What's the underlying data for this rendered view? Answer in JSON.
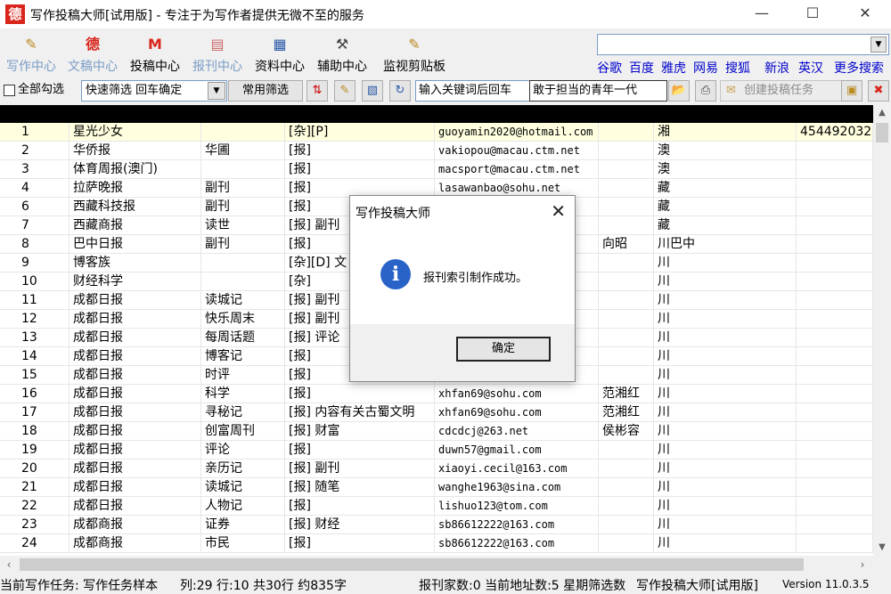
{
  "window": {
    "title": "写作投稿大师[试用版] - 专注于为写作者提供无微不至的服务",
    "icon_label": "德"
  },
  "nav": [
    {
      "label": "写作中心",
      "icon": "pencil-doc-icon",
      "dim": true
    },
    {
      "label": "文稿中心",
      "icon": "logo-icon",
      "dim": true
    },
    {
      "label": "投稿中心",
      "icon": "mail-icon",
      "dim": false
    },
    {
      "label": "报刊中心",
      "icon": "newspaper-icon",
      "dim": true
    },
    {
      "label": "资料中心",
      "icon": "book-icon",
      "dim": false
    },
    {
      "label": "辅助中心",
      "icon": "hammer-icon",
      "dim": false
    },
    {
      "label": "监视剪贴板",
      "icon": "clipboard-icon",
      "dim": false
    }
  ],
  "top_combo": {
    "value": ""
  },
  "search_links": [
    "谷歌",
    "百度",
    "雅虎",
    "网易",
    "搜狐",
    "新浪",
    "英汉",
    "更多搜索"
  ],
  "toolbar2": {
    "select_all": "全部勾选",
    "filter_select": "快速筛选  回车确定",
    "common_filter": "常用筛选",
    "keyword_input": "输入关键词后回车",
    "text_field": "敢于担当的青年一代",
    "create_task": "创建投稿任务"
  },
  "table": {
    "rows": [
      [
        "1",
        "星光少女",
        "",
        "[杂][P]",
        "guoyamin2020@hotmail.com",
        "",
        "湘",
        "454492032"
      ],
      [
        "2",
        "华侨报",
        "华圃",
        "[报]",
        "vakiopou@macau.ctm.net",
        "",
        "澳",
        ""
      ],
      [
        "3",
        "体育周报(澳门)",
        "",
        "[报]",
        "macsport@macau.ctm.net",
        "",
        "澳",
        ""
      ],
      [
        "4",
        "拉萨晚报",
        "副刊",
        "[报]",
        "lasawanbao@sohu.net",
        "",
        "藏",
        ""
      ],
      [
        "6",
        "西藏科技报",
        "副刊",
        "[报]",
        "",
        "",
        "藏",
        ""
      ],
      [
        "7",
        "西藏商报",
        "读世",
        "[报] 副刊",
        "",
        "",
        "藏",
        ""
      ],
      [
        "8",
        "巴中日报",
        "副刊",
        "[报]",
        "",
        "向昭",
        "川巴中",
        ""
      ],
      [
        "9",
        "博客族",
        "",
        "[杂][D] 文",
        "",
        "",
        "川",
        ""
      ],
      [
        "10",
        "财经科学",
        "",
        "[杂]",
        "",
        "",
        "川",
        ""
      ],
      [
        "11",
        "成都日报",
        "读城记",
        "[报] 副刊",
        "cn",
        "",
        "川",
        ""
      ],
      [
        "12",
        "成都日报",
        "快乐周末",
        "[报] 副刊",
        "",
        "",
        "川",
        ""
      ],
      [
        "13",
        "成都日报",
        "每周话题",
        "[报] 评论",
        "cn",
        "",
        "川",
        ""
      ],
      [
        "14",
        "成都日报",
        "博客记",
        "[报]",
        "cn",
        "",
        "川",
        ""
      ],
      [
        "15",
        "成都日报",
        "时评",
        "[报]",
        "",
        "",
        "川",
        ""
      ],
      [
        "16",
        "成都日报",
        "科学",
        "[报]",
        "xhfan69@sohu.com",
        "范湘红",
        "川",
        ""
      ],
      [
        "17",
        "成都日报",
        "寻秘记",
        "[报] 内容有关古蜀文明",
        "xhfan69@sohu.com",
        "范湘红",
        "川",
        ""
      ],
      [
        "18",
        "成都日报",
        "创富周刊",
        "[报] 财富",
        "cdcdcj@263.net",
        "侯彬容",
        "川",
        ""
      ],
      [
        "19",
        "成都日报",
        "评论",
        "[报]",
        "duwn57@gmail.com",
        "",
        "川",
        ""
      ],
      [
        "20",
        "成都日报",
        "亲历记",
        "[报] 副刊",
        "xiaoyi.cecil@163.com",
        "",
        "川",
        ""
      ],
      [
        "21",
        "成都日报",
        "读城记",
        "[报] 随笔",
        "wanghe1963@sina.com",
        "",
        "川",
        ""
      ],
      [
        "22",
        "成都日报",
        "人物记",
        "[报]",
        "lishuo123@tom.com",
        "",
        "川",
        ""
      ],
      [
        "23",
        "成都商报",
        "证券",
        "[报] 财经",
        "sb86612222@163.com",
        "",
        "川",
        ""
      ],
      [
        "24",
        "成都商报",
        "市民",
        "[报]",
        "sb86612222@163.com",
        "",
        "川",
        ""
      ]
    ]
  },
  "status": {
    "task": "当前写作任务: 写作任务样本",
    "cursor": "列:29 行:10 共30行 约835字",
    "counts": "报刊家数:0 当前地址数:5 星期筛选数",
    "app": "写作投稿大师[试用版]",
    "version": "Version 11.0.3.5"
  },
  "dialog": {
    "title": "写作投稿大师",
    "message": "报刊索引制作成功。",
    "ok": "确定"
  }
}
